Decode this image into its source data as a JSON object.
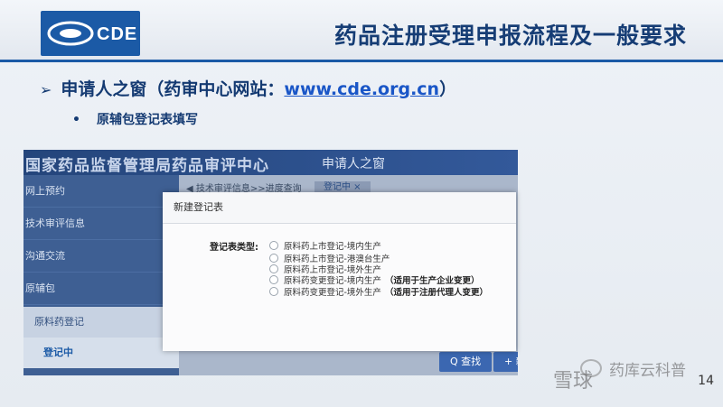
{
  "header": {
    "logo_text": "CDE",
    "title": "药品注册受理申报流程及一般要求"
  },
  "content": {
    "bullet1": {
      "label": "申请人之窗（药审中心网站：",
      "link": "www.cde.org.cn",
      "suffix": "）"
    },
    "bullet2": "原辅包登记表填写"
  },
  "screenshot": {
    "org_title": "国家药品监督管理局药品审评中心",
    "window_title": "申请人之窗",
    "sidebar": [
      "网上预约",
      "技术审评信息",
      "沟通交流",
      "原辅包"
    ],
    "sub_items": [
      "原料药登记",
      "登记中"
    ],
    "breadcrumb": "◀  技术审评信息>>进度查询",
    "tab_label": "登记中  ×",
    "buttons": {
      "query": "Q 查找",
      "new": "+ 新建"
    },
    "modal": {
      "title": "新建登记表",
      "field_label": "登记表类型:",
      "options": [
        {
          "label": "原料药上市登记-境内生产",
          "note": ""
        },
        {
          "label": "原料药上市登记-港澳台生产",
          "note": ""
        },
        {
          "label": "原料药上市登记-境外生产",
          "note": ""
        },
        {
          "label": "原料药变更登记-境内生产",
          "note": "（适用于生产企业变更）"
        },
        {
          "label": "原料药变更登记-境外生产",
          "note": "（适用于注册代理人变更）"
        }
      ]
    }
  },
  "footer": {
    "page_number": "14",
    "watermark_1": "雪球",
    "watermark_2": "药库云科普"
  }
}
